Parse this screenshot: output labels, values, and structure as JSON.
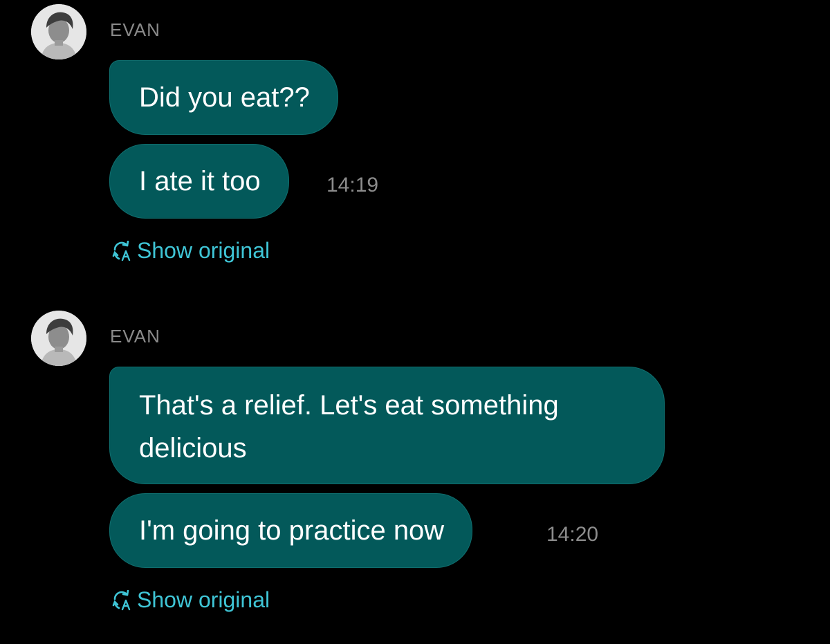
{
  "colors": {
    "background": "#000000",
    "bubble": "#03595a",
    "sender_name": "#8a8a8a",
    "timestamp": "#8c8c8c",
    "link": "#3fc5d6"
  },
  "groups": [
    {
      "sender": "EVAN",
      "avatar_icon": "profile-photo",
      "messages": [
        {
          "text": "Did you eat??"
        },
        {
          "text": "I ate it too"
        }
      ],
      "time": "14:19",
      "show_original_label": "Show original",
      "show_original_icon": "translate-icon"
    },
    {
      "sender": "EVAN",
      "avatar_icon": "profile-photo",
      "messages": [
        {
          "text": "That's a relief. Let's eat something delicious"
        },
        {
          "text": "I'm going to practice now"
        }
      ],
      "time": "14:20",
      "show_original_label": "Show original",
      "show_original_icon": "translate-icon"
    }
  ]
}
